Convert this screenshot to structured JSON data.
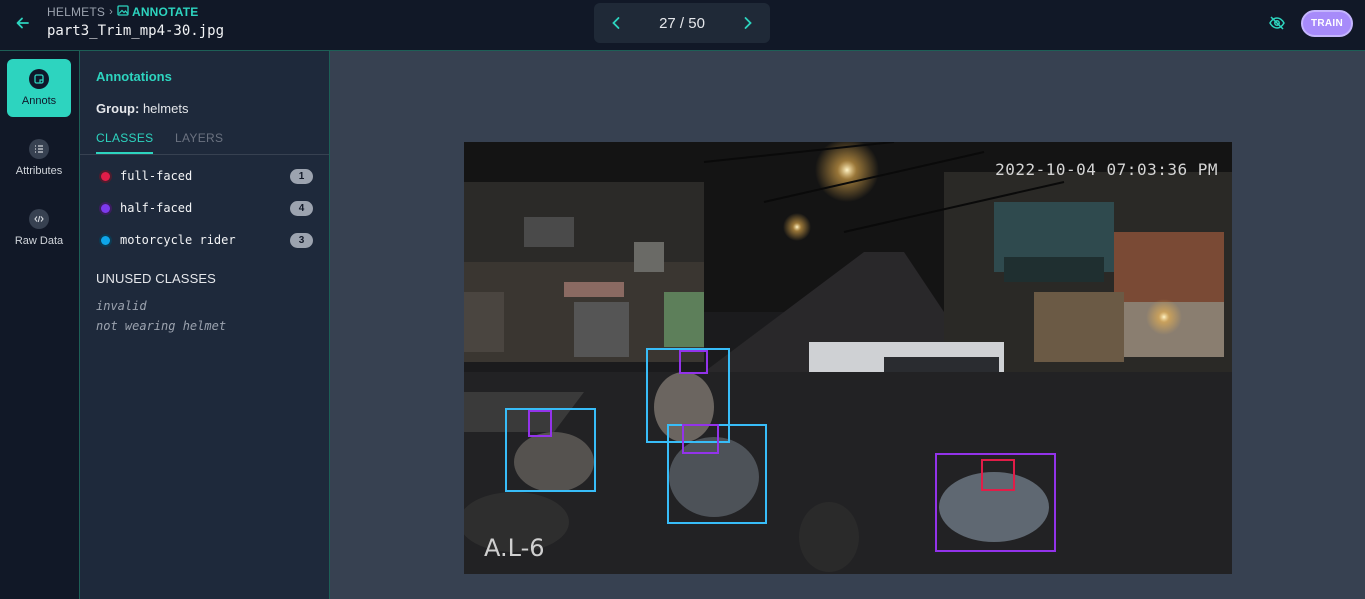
{
  "header": {
    "breadcrumb_root": "HELMETS",
    "breadcrumb_current": "ANNOTATE",
    "filename": "part3_Trim_mp4-30.jpg",
    "pager_text": "27 / 50",
    "train_label": "TRAIN"
  },
  "rail": {
    "items": [
      {
        "label": "Annots",
        "icon": "annotation-icon",
        "active": true
      },
      {
        "label": "Attributes",
        "icon": "list-icon",
        "active": false
      },
      {
        "label": "Raw Data",
        "icon": "code-icon",
        "active": false
      }
    ]
  },
  "panel": {
    "title": "Annotations",
    "group_label": "Group:",
    "group_value": "helmets",
    "tabs": [
      "CLASSES",
      "LAYERS"
    ],
    "classes": [
      {
        "name": "full-faced",
        "count": "1",
        "color": "#e11d48"
      },
      {
        "name": "half-faced",
        "count": "4",
        "color": "#7c3aed"
      },
      {
        "name": "motorcycle rider",
        "count": "3",
        "color": "#0ea5e9"
      }
    ],
    "unused_title": "UNUSED CLASSES",
    "unused": [
      "invalid",
      "not wearing helmet"
    ]
  },
  "image": {
    "timestamp": "2022-10-04 07:03:36 PM",
    "camera_label": "A.L-6"
  },
  "colors": {
    "accent": "#2dd4bf",
    "train": "#a78bfa",
    "rider_box": "#38bdf8",
    "half_faced_box": "#9333ea",
    "full_faced_box": "#e11d48"
  }
}
